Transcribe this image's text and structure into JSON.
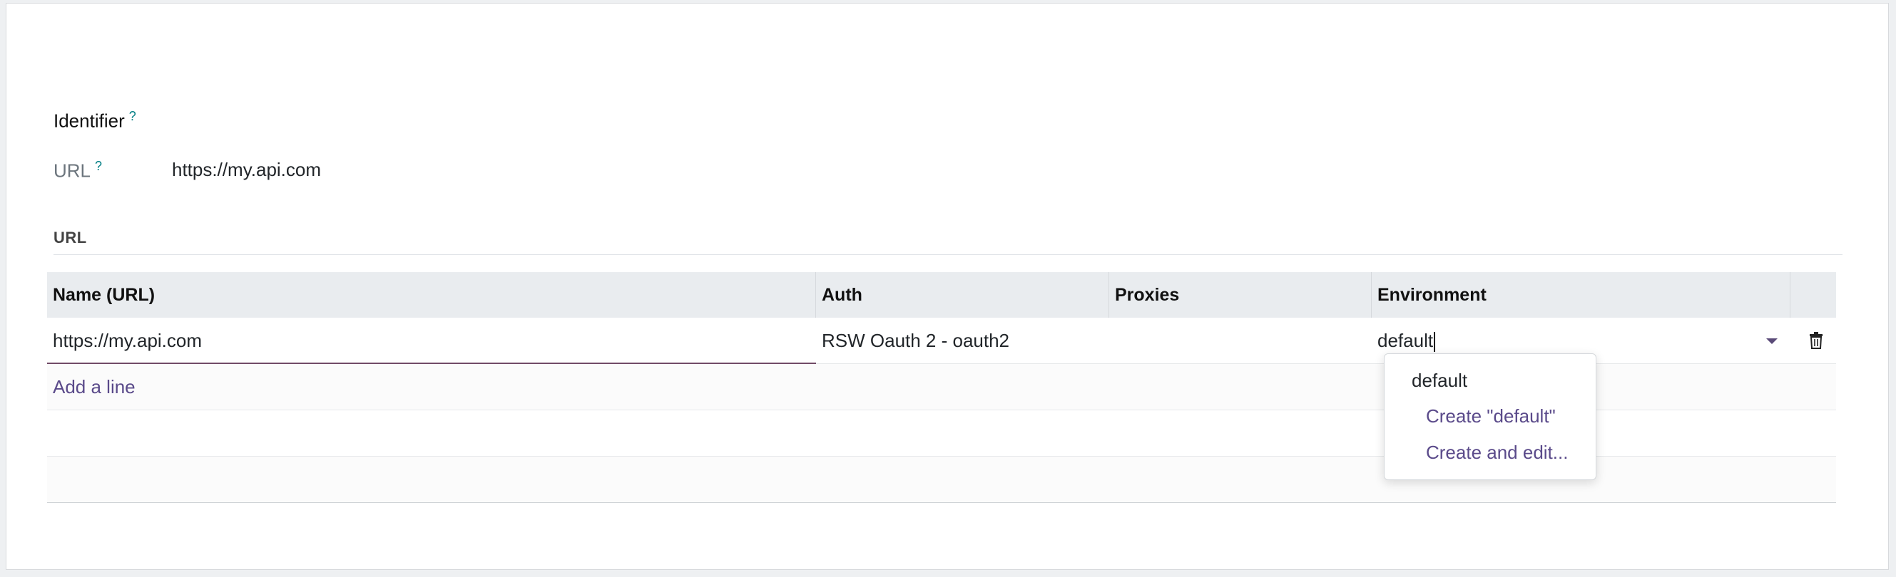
{
  "header": {
    "identifier_label": "Identifier",
    "help_mark": "?"
  },
  "url_field": {
    "label": "URL",
    "help_mark": "?",
    "value": "https://my.api.com"
  },
  "section": {
    "title": "URL"
  },
  "table": {
    "columns": [
      "Name (URL)",
      "Auth",
      "Proxies",
      "Environment"
    ],
    "rows": [
      {
        "name": "https://my.api.com",
        "auth": "RSW Oauth 2 - oauth2",
        "proxies": "",
        "environment": "default"
      }
    ],
    "add_line_label": "Add a line"
  },
  "dropdown": {
    "options": [
      "default"
    ],
    "create_label": "Create \"default\"",
    "create_edit_label": "Create and edit..."
  },
  "colors": {
    "accent": "#714b67",
    "link": "#5a4a8a",
    "help": "#017e84"
  }
}
